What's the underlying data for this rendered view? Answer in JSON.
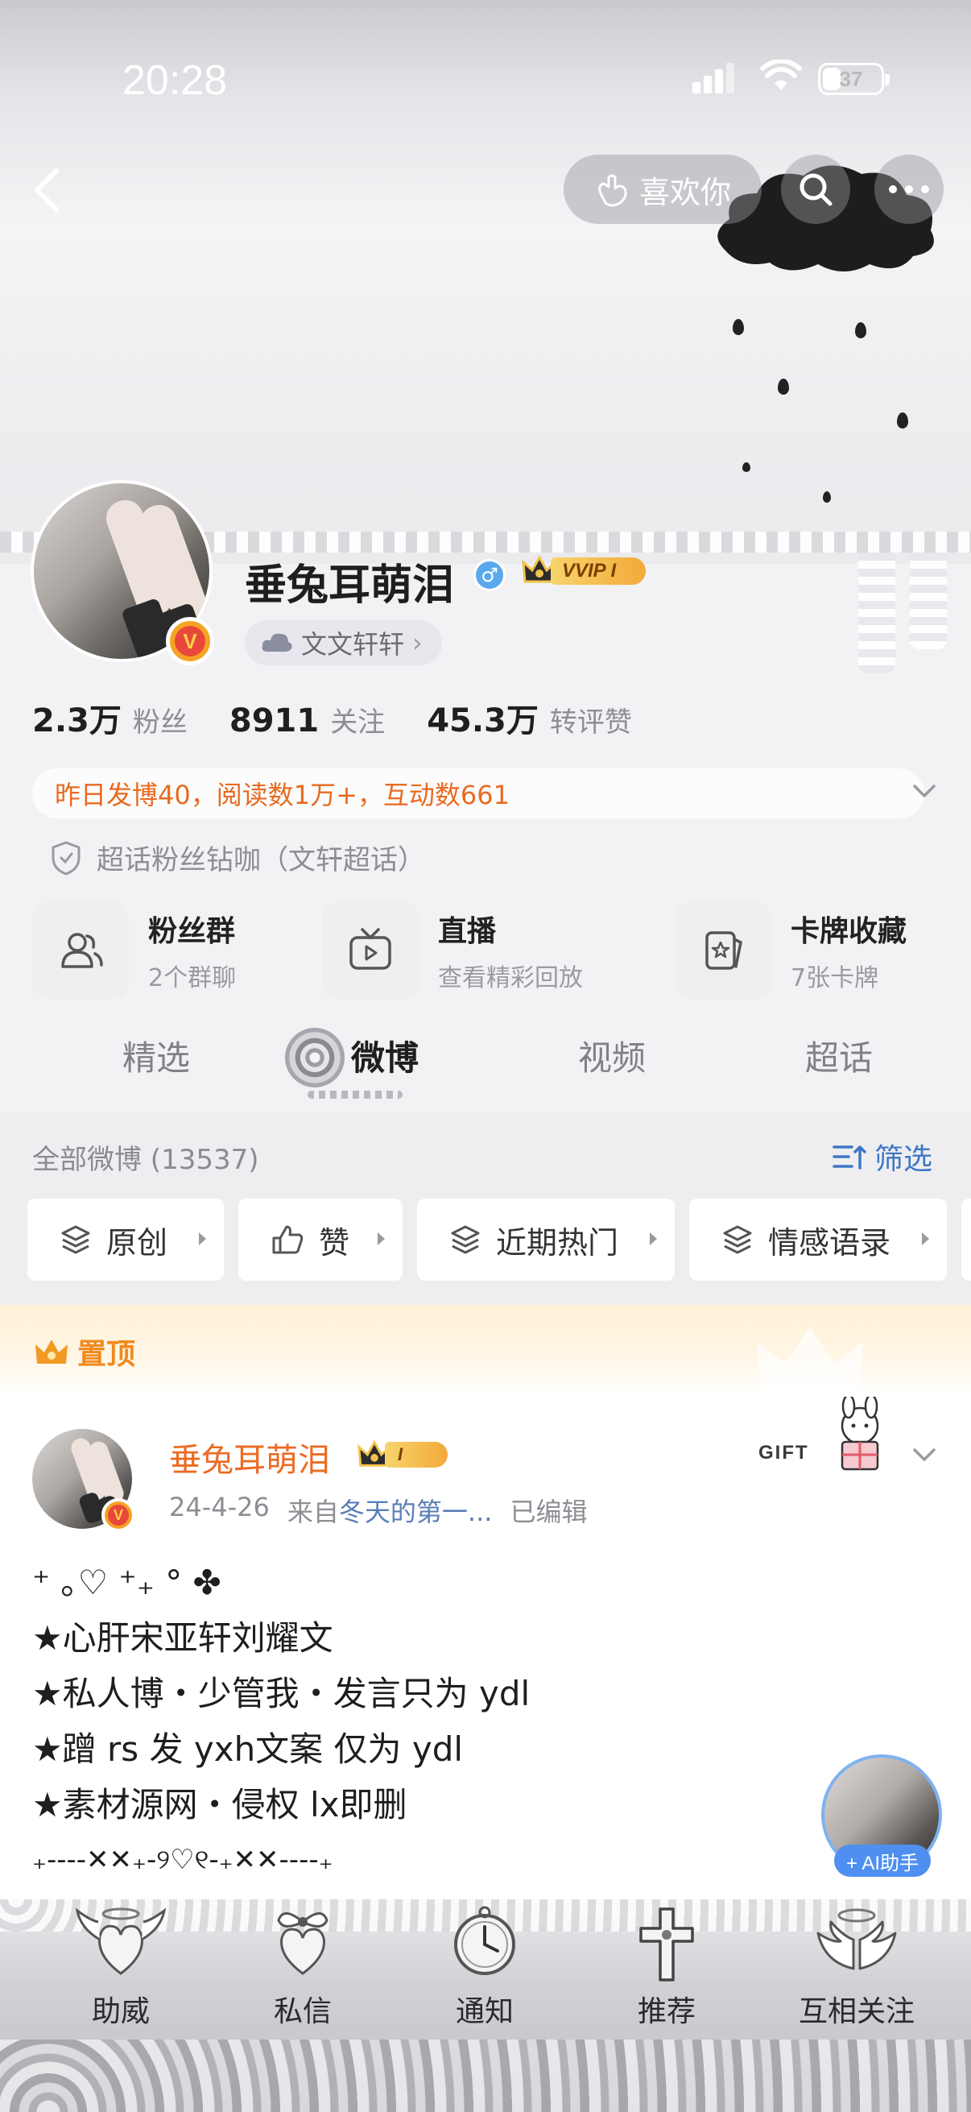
{
  "status_bar": {
    "time": "20:28",
    "battery": "37",
    "battery_level": 0.37
  },
  "top_bar": {
    "like_button_label": "喜欢你"
  },
  "profile": {
    "name": "垂兔耳萌泪",
    "vip_badge": "VVIP I",
    "fan_club_label": "文文轩轩",
    "stats": [
      {
        "value": "2.3万",
        "label": "粉丝"
      },
      {
        "value": "8911",
        "label": "关注"
      },
      {
        "value": "45.3万",
        "label": "转评赞"
      }
    ],
    "info_line": "昨日发博40，阅读数1万+，互动数661",
    "supertopic_line": "超话粉丝钻咖（文轩超话）"
  },
  "features": [
    {
      "title": "粉丝群",
      "subtitle": "2个群聊"
    },
    {
      "title": "直播",
      "subtitle": "查看精彩回放"
    },
    {
      "title": "卡牌收藏",
      "subtitle": "7张卡牌"
    }
  ],
  "tabs": [
    "精选",
    "微博",
    "视频",
    "超话"
  ],
  "feed": {
    "all_posts_label": "全部微博 (13537)",
    "filter_label": "筛选",
    "chips": [
      "原创",
      "赞",
      "近期热门",
      "情感语录"
    ],
    "pinned_label": "置顶"
  },
  "post": {
    "author": "垂兔耳萌泪",
    "badge": "I",
    "date": "24-4-26",
    "source_prefix": "来自",
    "source_name": "冬天的第一...",
    "edited": "已编辑",
    "sticker_text": "GIFT",
    "lines": [
      "⁺ ｡♡ ⁺₊ ° ✤",
      "★心肝宋亚轩刘耀文",
      "★私人博・少管我・发言只为 ydl",
      "★蹭 rs 发 yxh文案 仅为 ydl",
      "★素材源网・侵权 lx即删",
      "₊----✕✕₊-୨♡୧-₊✕✕----₊"
    ]
  },
  "ai_helper": {
    "label": "+ AI助手"
  },
  "bottom_nav": [
    "助威",
    "私信",
    "通知",
    "推荐",
    "互相关注"
  ]
}
